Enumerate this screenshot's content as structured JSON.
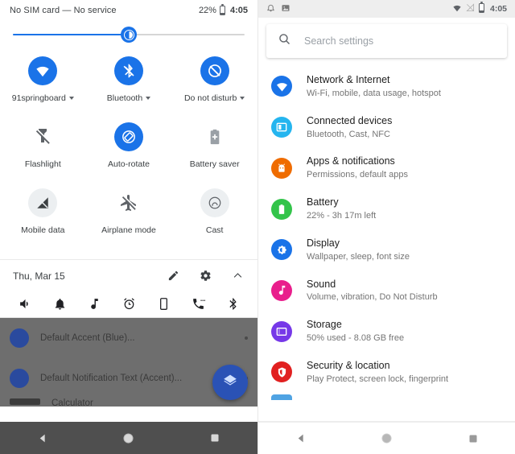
{
  "quick_settings": {
    "status_bar": {
      "carrier": "No SIM card — No service",
      "battery_percent": "22%",
      "time": "4:05"
    },
    "brightness": {
      "label": "brightness-slider",
      "value_percent": 50
    },
    "tiles": [
      {
        "label": "91springboard",
        "icon": "wifi-icon",
        "state": "on",
        "expandable": true
      },
      {
        "label": "Bluetooth",
        "icon": "bluetooth-off-icon",
        "state": "on",
        "expandable": true
      },
      {
        "label": "Do not disturb",
        "icon": "dnd-off-icon",
        "state": "on",
        "expandable": true
      },
      {
        "label": "Flashlight",
        "icon": "flashlight-off-icon",
        "state": "plain",
        "expandable": false
      },
      {
        "label": "Auto-rotate",
        "icon": "autorotate-icon",
        "state": "on",
        "expandable": false
      },
      {
        "label": "Battery saver",
        "icon": "battery-saver-icon",
        "state": "plain",
        "expandable": false
      },
      {
        "label": "Mobile data",
        "icon": "mobile-data-off-icon",
        "state": "off",
        "expandable": false
      },
      {
        "label": "Airplane mode",
        "icon": "airplane-off-icon",
        "state": "plain",
        "expandable": false
      },
      {
        "label": "Cast",
        "icon": "cast-icon",
        "state": "off",
        "expandable": false
      }
    ],
    "footer": {
      "date": "Thu, Mar 15",
      "edit_label": "edit-tiles",
      "settings_label": "settings",
      "collapse_label": "collapse"
    },
    "notification_icons": [
      "volume-icon",
      "bell-icon",
      "music-note-icon",
      "alarm-icon",
      "phone-icon",
      "call-icon",
      "bluetooth-icon"
    ],
    "notifications": [
      {
        "title": "Default Accent (Blue)..."
      },
      {
        "title": "Default Notification Text (Accent)..."
      },
      {
        "title": "Calculator"
      }
    ],
    "fab": {
      "icon": "layers-icon"
    },
    "nav_bar": {
      "back": "back-button",
      "home": "home-button",
      "recents": "recents-button"
    }
  },
  "settings": {
    "status_bar": {
      "notif_icons": [
        "bell-icon",
        "image-icon"
      ],
      "system_icons": [
        "wifi-icon",
        "no-sim-icon",
        "battery-icon"
      ],
      "time": "4:05"
    },
    "search": {
      "placeholder": "Search settings",
      "value": "",
      "icon": "search-icon"
    },
    "items": [
      {
        "title": "Network & Internet",
        "subtitle": "Wi-Fi, mobile, data usage, hotspot",
        "icon": "wifi-icon",
        "color": "#1a73e8"
      },
      {
        "title": "Connected devices",
        "subtitle": "Bluetooth, Cast, NFC",
        "icon": "devices-icon",
        "color": "#25b5ef"
      },
      {
        "title": "Apps & notifications",
        "subtitle": "Permissions, default apps",
        "icon": "android-icon",
        "color": "#ef6c00"
      },
      {
        "title": "Battery",
        "subtitle": "22% - 3h 17m left",
        "icon": "battery-icon",
        "color": "#33c44a"
      },
      {
        "title": "Display",
        "subtitle": "Wallpaper, sleep, font size",
        "icon": "brightness-icon",
        "color": "#1a73e8"
      },
      {
        "title": "Sound",
        "subtitle": "Volume, vibration, Do Not Disturb",
        "icon": "music-note-icon",
        "color": "#e91e8c"
      },
      {
        "title": "Storage",
        "subtitle": "50% used - 8.08 GB free",
        "icon": "storage-icon",
        "color": "#7638e8"
      },
      {
        "title": "Security & location",
        "subtitle": "Play Protect, screen lock, fingerprint",
        "icon": "shield-icon",
        "color": "#e12020"
      }
    ],
    "nav_bar": {
      "back": "back-button",
      "home": "home-button",
      "recents": "recents-button"
    }
  }
}
